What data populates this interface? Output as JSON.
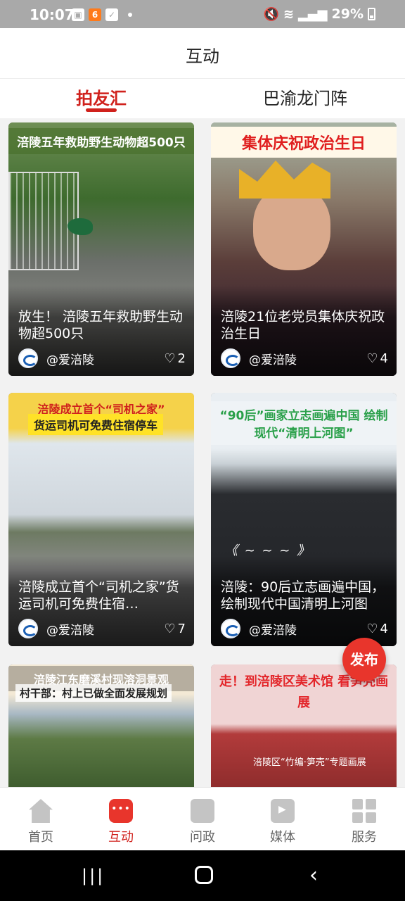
{
  "status_bar": {
    "time": "10:07",
    "battery_percent": "29%",
    "icons_left": [
      "image-icon",
      "app-badge-icon",
      "check-icon",
      "dot-icon"
    ],
    "icons_right": [
      "mute-icon",
      "wifi-icon",
      "signal-icon",
      "battery-icon"
    ]
  },
  "header": {
    "title": "互动"
  },
  "tabs": [
    {
      "label": "拍友汇",
      "active": true
    },
    {
      "label": "巴渝龙门阵",
      "active": false
    }
  ],
  "cards": [
    {
      "image_banner": "涪陵五年救助野生动物超500只",
      "title": "放生！ 涪陵五年救助野生动物超500只",
      "author": "@爱涪陵",
      "likes": "2"
    },
    {
      "image_banner": "集体庆祝政治生日",
      "title": "涪陵21位老党员集体庆祝政治生日",
      "author": "@爱涪陵",
      "likes": "4"
    },
    {
      "image_banner": "涪陵成立首个“司机之家”",
      "image_banner2": "货运司机可免费住宿停车",
      "title": "涪陵成立首个“司机之家”货运司机可免费住宿…",
      "author": "@爱涪陵",
      "likes": "7"
    },
    {
      "image_banner": "“90后”画家立志画遍中国 绘制现代“清明上河图”",
      "title": "涪陵：90后立志画遍中国，绘制现代中国清明上河图",
      "author": "@爱涪陵",
      "likes": "4"
    },
    {
      "image_banner": "涪陵江东磨溪村现溶洞景观",
      "image_banner2": "村干部：村上已做全面发展规划"
    },
    {
      "image_banner": "走！到涪陵区美术馆 看笋壳画展",
      "sign_text": "涪陵区“竹编·笋壳”专题画展"
    }
  ],
  "publish_button": {
    "label": "发布"
  },
  "bottom_nav": [
    {
      "label": "首页",
      "icon": "home-icon",
      "active": false
    },
    {
      "label": "互动",
      "icon": "chat-icon",
      "active": true
    },
    {
      "label": "问政",
      "icon": "document-icon",
      "active": false
    },
    {
      "label": "媒体",
      "icon": "media-icon",
      "active": false
    },
    {
      "label": "服务",
      "icon": "grid-icon",
      "active": false
    }
  ],
  "colors": {
    "accent": "#d0211c",
    "publish": "#e8352c"
  }
}
